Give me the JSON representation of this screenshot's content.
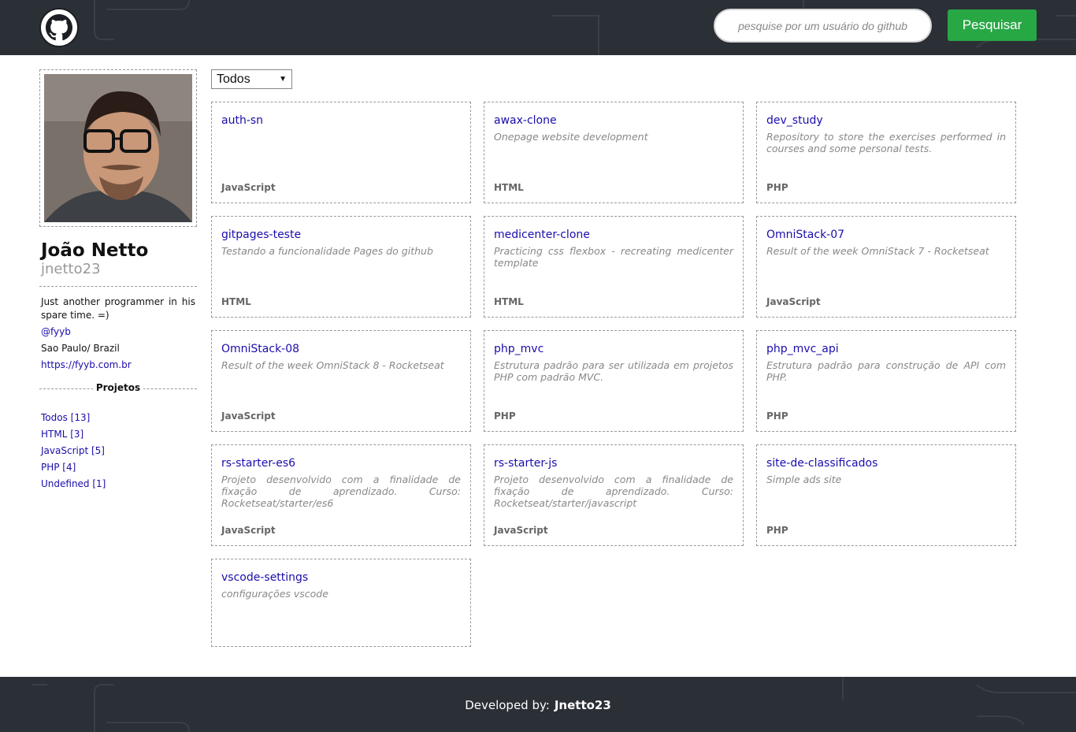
{
  "header": {
    "logo_icon": "github-octocat-icon",
    "search_placeholder": "pesquise por um usuário do github",
    "search_button": "Pesquisar"
  },
  "profile": {
    "name": "João Netto",
    "login": "jnetto23",
    "bio": "Just another programmer in his spare time. =)",
    "company": "@fyyb",
    "location": "Sao Paulo/ Brazil",
    "blog": "https://fyyb.com.br"
  },
  "projects_section": {
    "title": "Projetos",
    "filters": [
      {
        "label": "Todos [13]"
      },
      {
        "label": "HTML [3]"
      },
      {
        "label": "JavaScript [5]"
      },
      {
        "label": "PHP [4]"
      },
      {
        "label": "Undefined [1]"
      }
    ]
  },
  "filter_select": {
    "selected": "Todos"
  },
  "repos": [
    {
      "name": "auth-sn",
      "description": "",
      "language": "JavaScript"
    },
    {
      "name": "awax-clone",
      "description": "Onepage website development",
      "language": "HTML"
    },
    {
      "name": "dev_study",
      "description": "Repository to store the exercises performed in courses and some personal tests.",
      "language": "PHP"
    },
    {
      "name": "gitpages-teste",
      "description": "Testando a funcionalidade Pages do github",
      "language": "HTML"
    },
    {
      "name": "medicenter-clone",
      "description": "Practicing css flexbox - recreating medicenter template",
      "language": "HTML"
    },
    {
      "name": "OmniStack-07",
      "description": "Result of the week OmniStack 7 - Rocketseat",
      "language": "JavaScript"
    },
    {
      "name": "OmniStack-08",
      "description": "Result of the week OmniStack 8 - Rocketseat",
      "language": "JavaScript"
    },
    {
      "name": "php_mvc",
      "description": "Estrutura padrão para ser utilizada em projetos PHP com padrão MVC.",
      "language": "PHP"
    },
    {
      "name": "php_mvc_api",
      "description": "Estrutura padrão para construção de API com PHP.",
      "language": "PHP"
    },
    {
      "name": "rs-starter-es6",
      "description": "Projeto desenvolvido com a finalidade de fixação de aprendizado. Curso: Rocketseat/starter/es6",
      "language": "JavaScript"
    },
    {
      "name": "rs-starter-js",
      "description": "Projeto desenvolvido com a finalidade de fixação de aprendizado. Curso: Rocketseat/starter/javascript",
      "language": "JavaScript"
    },
    {
      "name": "site-de-classificados",
      "description": "Simple ads site",
      "language": "PHP"
    },
    {
      "name": "vscode-settings",
      "description": "configurações vscode",
      "language": ""
    }
  ],
  "footer": {
    "prefix": "Developed by:",
    "author": "Jnetto23"
  }
}
